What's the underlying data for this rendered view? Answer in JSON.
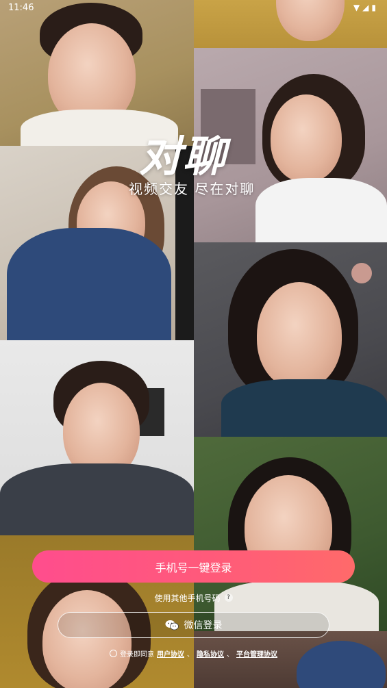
{
  "status_bar": {
    "time": "11:46",
    "icons": [
      "wifi-icon",
      "signal-icon",
      "battery-icon"
    ]
  },
  "brand": {
    "title": "对聊",
    "slogan": "视频交友 尽在对聊"
  },
  "login": {
    "primary_button": "手机号一键登录",
    "other_phone": "使用其他手机号码",
    "help_icon": "?",
    "wechat_button": "微信登录",
    "wechat_icon": "wechat-icon"
  },
  "agreement": {
    "prefix": "登录即同意",
    "user_agreement": "用户协议",
    "sep1": "、",
    "privacy_agreement": "隐私协议",
    "sep2": "、",
    "platform_agreement": "平台管理协议"
  },
  "theme": {
    "accent_start": "#ff4d8d",
    "accent_end": "#ff6a6a",
    "text": "#ffffff"
  }
}
